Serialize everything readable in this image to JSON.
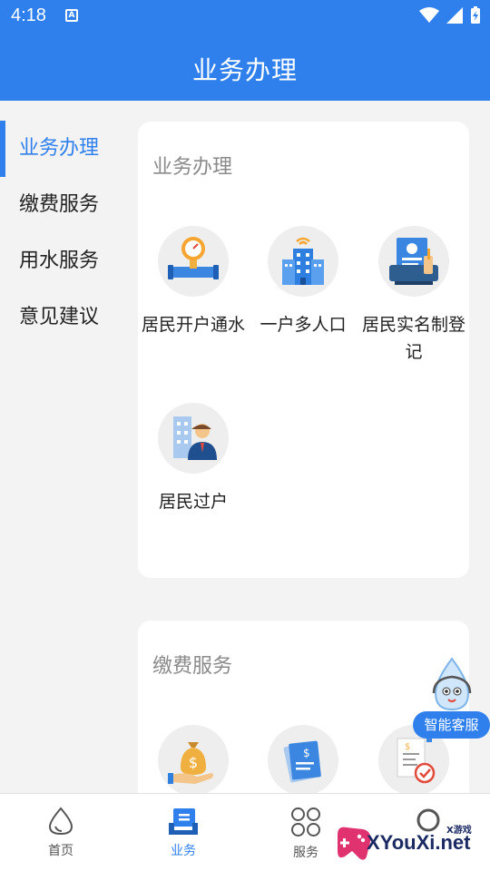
{
  "status": {
    "time": "4:18",
    "a_icon": "A"
  },
  "header": {
    "title": "业务办理"
  },
  "sidebar": {
    "items": [
      {
        "label": "业务办理",
        "active": true
      },
      {
        "label": "缴费服务",
        "active": false
      },
      {
        "label": "用水服务",
        "active": false
      },
      {
        "label": "意见建议",
        "active": false
      }
    ]
  },
  "business": {
    "title": "业务办理",
    "services": [
      {
        "label": "居民开户通水",
        "icon": "water-meter-icon"
      },
      {
        "label": "一户多人口",
        "icon": "building-icon"
      },
      {
        "label": "居民实名制登记",
        "icon": "id-registration-icon"
      },
      {
        "label": "居民过户",
        "icon": "transfer-owner-icon"
      }
    ]
  },
  "payment": {
    "title": "缴费服务",
    "services": [
      {
        "icon": "money-bag-icon"
      },
      {
        "icon": "bill-document-icon"
      },
      {
        "icon": "invoice-check-icon"
      }
    ]
  },
  "chat": {
    "label": "智能客服"
  },
  "bottom_nav": {
    "items": [
      {
        "label": "首页",
        "icon": "drop-icon",
        "active": false
      },
      {
        "label": "业务",
        "icon": "business-icon",
        "active": true
      },
      {
        "label": "服务",
        "icon": "grid-icon",
        "active": false
      }
    ]
  },
  "watermark": {
    "site": "XYouXi.net",
    "cn": "X游戏"
  },
  "colors": {
    "primary": "#2f80ed",
    "background": "#f3f3f3",
    "card": "#ffffff",
    "muted_title": "#8a8a8a"
  }
}
